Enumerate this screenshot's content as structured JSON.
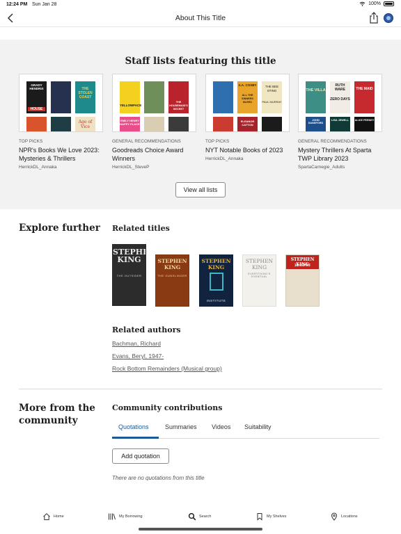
{
  "status_bar": {
    "time": "12:24 PM",
    "date": "Sun Jan 28",
    "battery": "100%"
  },
  "header": {
    "title": "About This Title"
  },
  "staff_lists": {
    "heading": "Staff lists featuring this title",
    "lists": [
      {
        "kind": "TOP PICKS",
        "name": "NPR's Books We Love 2023: Mysteries & Thrillers",
        "owner": "HerrickDL_Annaka"
      },
      {
        "kind": "GENERAL RECOMMENDATIONS",
        "name": "Goodreads Choice Award Winners",
        "owner": "HerrickDL_SteveP"
      },
      {
        "kind": "TOP PICKS",
        "name": "NYT Notable Books of 2023",
        "owner": "HerrickDL_Annaka"
      },
      {
        "kind": "GENERAL RECOMMENDATIONS",
        "name": "Mystery Thrillers At Sparta TWP Library 2023",
        "owner": "SpartaCarnegie_Adults"
      }
    ],
    "cover_texts": {
      "list1": [
        "GRADY HENDRIX",
        "HOUSE",
        "THE STOLEN COAST",
        "Age of Vice"
      ],
      "list2": [
        "YELLOWFACE",
        "THE HOUSEMAID'S SECRET",
        "EMILY HENRY HAPPY PLACE"
      ],
      "list3": [
        "S.A. COSBY",
        "ALL THE SINNERS BLEED",
        "THE BEE STING",
        "PAUL MURRAY",
        "ELEANOR CATTON"
      ],
      "list4": [
        "THE VILLA",
        "RUTH WARE",
        "ZERO DAYS",
        "THE MAID",
        "JOHN SANDFORD",
        "LISA JEWELL",
        "ALICE FEENEY"
      ]
    },
    "view_all_label": "View all lists"
  },
  "explore": {
    "heading": "Explore further",
    "related_titles_heading": "Related titles",
    "covers": [
      {
        "author": "STEPHEN KING",
        "subtitle": "THE OUTSIDER",
        "bg": "#2c2c2c",
        "fg": "#e8e8e8"
      },
      {
        "author": "STEPHEN KING",
        "subtitle": "THE GUNSLINGER",
        "bg": "#8a3a12",
        "fg": "#f0d9a8"
      },
      {
        "author": "STEPHEN KING",
        "subtitle": "INSTITUTE",
        "bg": "#10233f",
        "fg": "#e6b13a"
      },
      {
        "author": "STEPHEN KING",
        "subtitle": "EVERYTHING'S EVENTUAL",
        "bg": "#f3f1ec",
        "fg": "#8c8c8c"
      },
      {
        "author": "STEPHEN KING",
        "subtitle": "11/22/63",
        "bg": "#e8dfcc",
        "fg": "#c0231c"
      }
    ],
    "related_authors_heading": "Related authors",
    "authors": [
      "Bachman, Richard",
      "Evans, Beryl, 1947-",
      "Rock Bottom Remainders (Musical group)"
    ]
  },
  "community": {
    "heading": "More from the community",
    "contributions_heading": "Community contributions",
    "tabs": [
      "Quotations",
      "Summaries",
      "Videos",
      "Suitability"
    ],
    "active_tab": "Quotations",
    "add_label": "Add quotation",
    "empty_text": "There are no quotations from this title"
  },
  "nav": {
    "items": [
      "Home",
      "My Borrowing",
      "Search",
      "My Shelves",
      "Locations"
    ]
  },
  "colors": {
    "accent": "#1a5a94",
    "staff_bg": "#f2f2f2"
  }
}
